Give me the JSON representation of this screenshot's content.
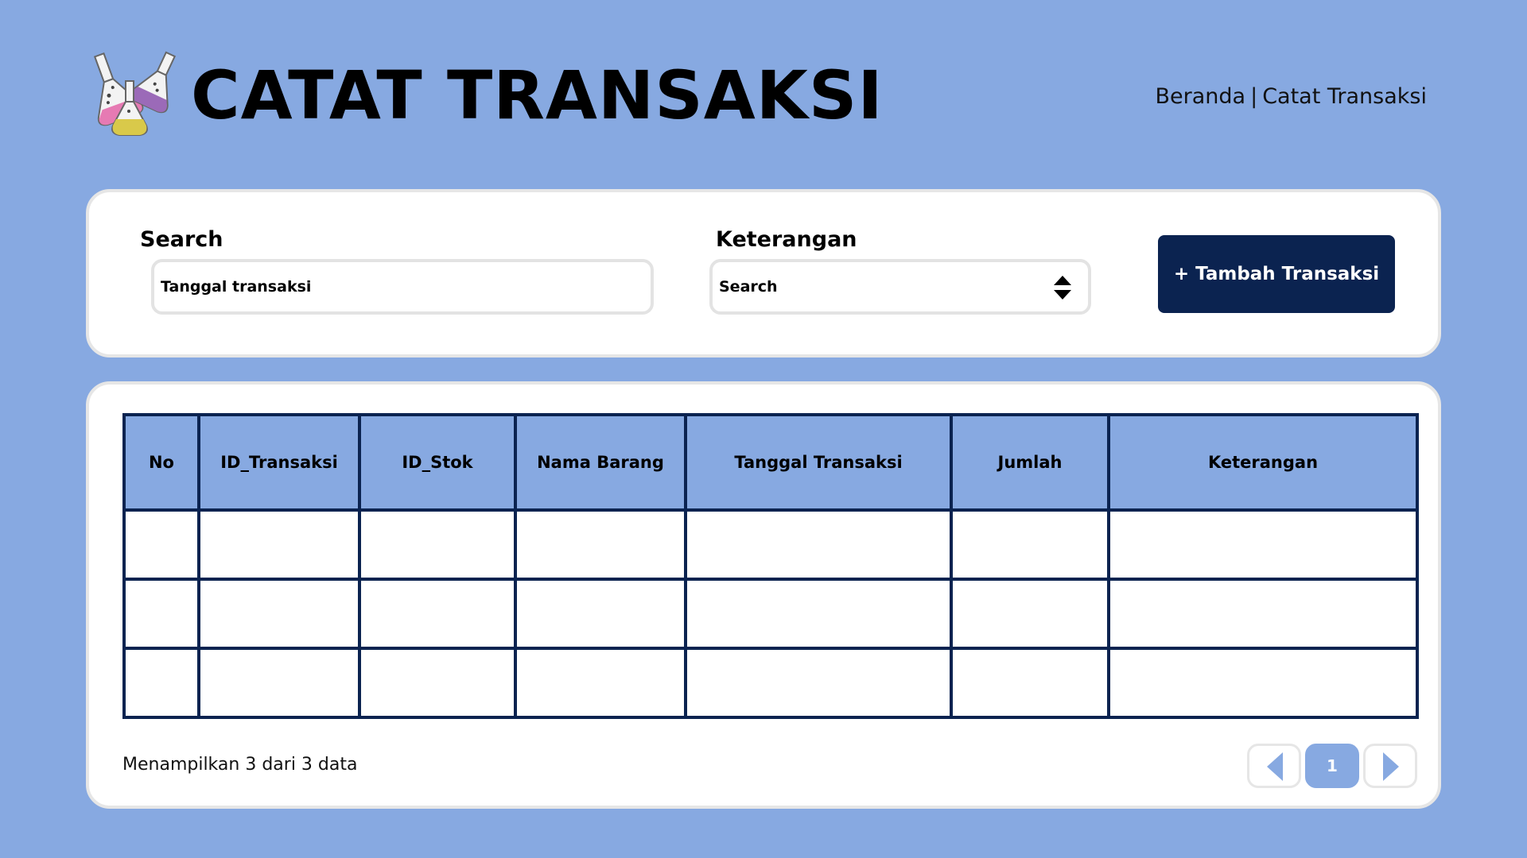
{
  "header": {
    "title": "CATAT TRANSAKSI",
    "breadcrumb": [
      "Beranda",
      "Catat Transaksi"
    ],
    "breadcrumb_separator": "|",
    "logo_icon": "lab-flasks-icon"
  },
  "filters": {
    "search_label": "Search",
    "search_placeholder": "Tanggal transaksi",
    "keterangan_label": "Keterangan",
    "keterangan_value": "Search",
    "add_button_label": "+ Tambah Transaksi"
  },
  "table": {
    "columns": [
      "No",
      "ID_Transaksi",
      "ID_Stok",
      "Nama Barang",
      "Tanggal Transaksi",
      "Jumlah",
      "Keterangan"
    ],
    "rows": [
      [
        "",
        "",
        "",
        "",
        "",
        "",
        ""
      ],
      [
        "",
        "",
        "",
        "",
        "",
        "",
        ""
      ],
      [
        "",
        "",
        "",
        "",
        "",
        "",
        ""
      ]
    ]
  },
  "footer": {
    "info": "Menampilkan 3 dari 3 data",
    "current_page": "1"
  },
  "colors": {
    "background": "#87a9e1",
    "primary_dark": "#0b2350",
    "card": "#ffffff"
  }
}
